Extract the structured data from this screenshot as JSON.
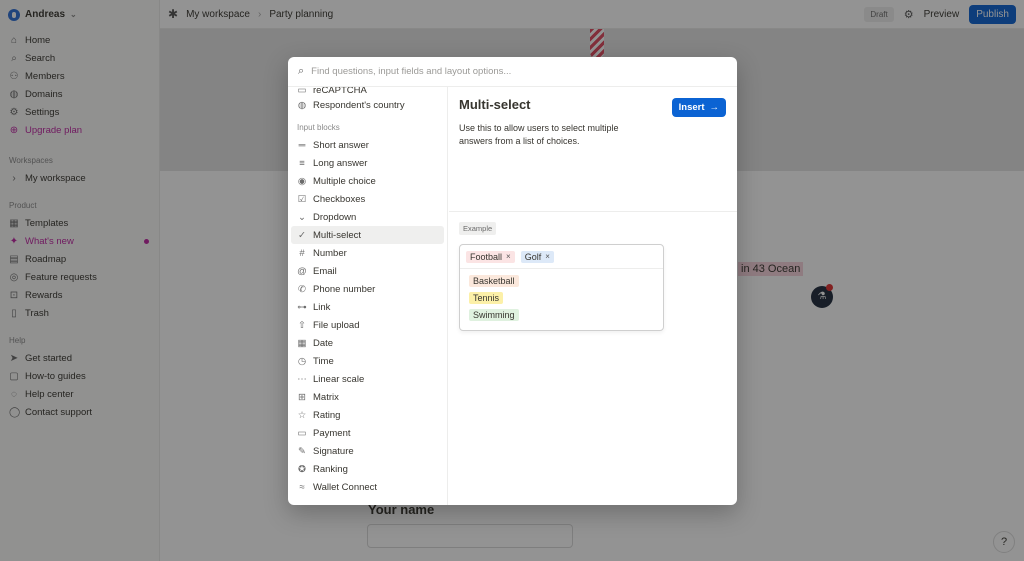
{
  "sidebar": {
    "workspace_name": "Andreas",
    "nav": [
      {
        "label": "Home",
        "icon": "home-icon"
      },
      {
        "label": "Search",
        "icon": "search-icon"
      },
      {
        "label": "Members",
        "icon": "members-icon"
      },
      {
        "label": "Domains",
        "icon": "globe-icon"
      },
      {
        "label": "Settings",
        "icon": "gear-icon"
      },
      {
        "label": "Upgrade plan",
        "icon": "upgrade-icon"
      }
    ],
    "workspaces_label": "Workspaces",
    "workspace_item": "My workspace",
    "product_label": "Product",
    "product": [
      {
        "label": "Templates",
        "icon": "templates-icon"
      },
      {
        "label": "What's new",
        "icon": "sparkle-icon"
      },
      {
        "label": "Roadmap",
        "icon": "roadmap-icon"
      },
      {
        "label": "Feature requests",
        "icon": "feature-requests-icon"
      },
      {
        "label": "Rewards",
        "icon": "gift-icon"
      },
      {
        "label": "Trash",
        "icon": "trash-icon"
      }
    ],
    "help_label": "Help",
    "help": [
      {
        "label": "Get started",
        "icon": "send-icon"
      },
      {
        "label": "How-to guides",
        "icon": "guide-icon"
      },
      {
        "label": "Help center",
        "icon": "help-center-icon"
      },
      {
        "label": "Contact support",
        "icon": "chat-icon"
      }
    ]
  },
  "topbar": {
    "crumb_workspace": "My workspace",
    "crumb_page": "Party planning",
    "draft": "Draft",
    "preview": "Preview",
    "publish": "Publish"
  },
  "background": {
    "ocean_text": "in 43 Ocean",
    "your_name": "Your name",
    "help_button": "?"
  },
  "modal": {
    "search_placeholder": "Find questions, input fields and layout options...",
    "partial_item": "reCAPTCHA",
    "respondents_country": "Respondent's country",
    "input_blocks_label": "Input blocks",
    "blocks": [
      {
        "label": "Short answer",
        "icon": "short-answer-icon"
      },
      {
        "label": "Long answer",
        "icon": "long-answer-icon"
      },
      {
        "label": "Multiple choice",
        "icon": "multiple-choice-icon"
      },
      {
        "label": "Checkboxes",
        "icon": "checkbox-icon"
      },
      {
        "label": "Dropdown",
        "icon": "chevron-down-icon"
      },
      {
        "label": "Multi-select",
        "icon": "multi-select-icon"
      },
      {
        "label": "Number",
        "icon": "hash-icon"
      },
      {
        "label": "Email",
        "icon": "at-icon"
      },
      {
        "label": "Phone number",
        "icon": "phone-icon"
      },
      {
        "label": "Link",
        "icon": "link-icon"
      },
      {
        "label": "File upload",
        "icon": "upload-icon"
      },
      {
        "label": "Date",
        "icon": "calendar-icon"
      },
      {
        "label": "Time",
        "icon": "clock-icon"
      },
      {
        "label": "Linear scale",
        "icon": "linear-scale-icon"
      },
      {
        "label": "Matrix",
        "icon": "matrix-icon"
      },
      {
        "label": "Rating",
        "icon": "star-icon"
      },
      {
        "label": "Payment",
        "icon": "card-icon"
      },
      {
        "label": "Signature",
        "icon": "pen-icon"
      },
      {
        "label": "Ranking",
        "icon": "ranking-icon"
      },
      {
        "label": "Wallet Connect",
        "icon": "wallet-icon"
      }
    ],
    "active_block": "Multi-select",
    "detail_title": "Multi-select",
    "detail_description": "Use this to allow users to select multiple answers from a list of choices.",
    "insert_label": "Insert",
    "example_label": "Example",
    "selected_chips": [
      "Football",
      "Golf"
    ],
    "options": [
      "Basketball",
      "Tennis",
      "Swimming"
    ]
  },
  "colors": {
    "accent": "#0b63d3",
    "upgrade": "#c026a3",
    "chip_red": "#fbe4e4",
    "chip_blue": "#dde9f8",
    "opt_orange": "#fbe8dc",
    "opt_yellow": "#fcf0a8",
    "opt_green": "#dff1df"
  }
}
